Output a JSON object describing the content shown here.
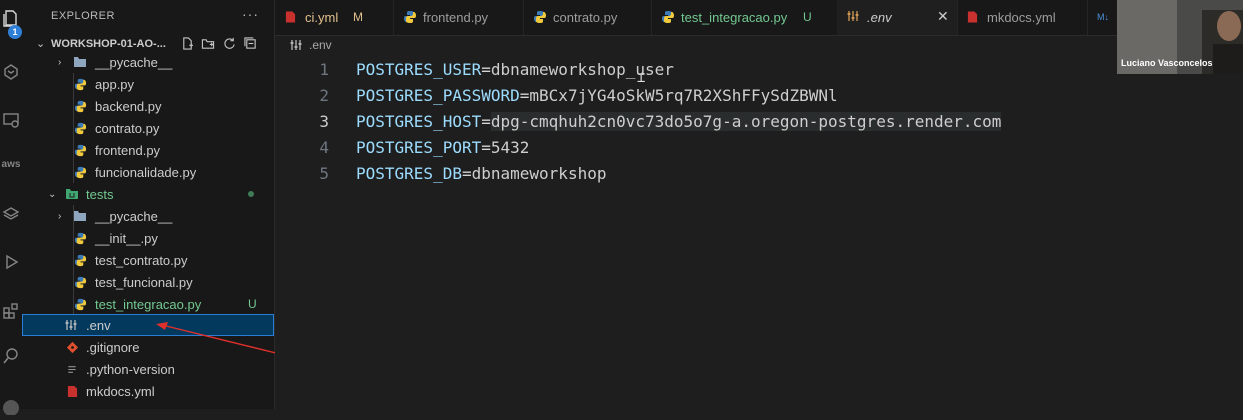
{
  "activity_bar": {
    "explorer_badge": "1",
    "items": [
      "files-icon",
      "remote-icon",
      "remote-explorer-icon",
      "aws-icon",
      "layers-icon",
      "run-debug-icon",
      "extensions-icon",
      "search-icon",
      "account-icon"
    ],
    "aws_label": "aws"
  },
  "sidebar": {
    "header": "EXPLORER",
    "more": "···",
    "workspace": "WORKSHOP-01-AO-...",
    "tree": [
      {
        "label": "__pycache__",
        "kind": "folder"
      },
      {
        "label": "app.py",
        "kind": "py"
      },
      {
        "label": "backend.py",
        "kind": "py"
      },
      {
        "label": "contrato.py",
        "kind": "py"
      },
      {
        "label": "frontend.py",
        "kind": "py"
      },
      {
        "label": "funcionalidade.py",
        "kind": "py"
      },
      {
        "label": "tests",
        "kind": "test-folder"
      },
      {
        "label": "__pycache__",
        "kind": "folder"
      },
      {
        "label": "__init__.py",
        "kind": "py"
      },
      {
        "label": "test_contrato.py",
        "kind": "py"
      },
      {
        "label": "test_funcional.py",
        "kind": "py"
      },
      {
        "label": "test_integracao.py",
        "kind": "py",
        "status": "U"
      },
      {
        "label": ".env",
        "kind": "env"
      },
      {
        "label": ".gitignore",
        "kind": "git"
      },
      {
        "label": ".python-version",
        "kind": "text"
      },
      {
        "label": "mkdocs.yml",
        "kind": "yml"
      }
    ]
  },
  "tabs": [
    {
      "label": "ci.yml",
      "mark": "M",
      "icon": "yaml-icon"
    },
    {
      "label": "frontend.py",
      "icon": "python-icon"
    },
    {
      "label": "contrato.py",
      "icon": "python-icon"
    },
    {
      "label": "test_integracao.py",
      "mark": "U",
      "icon": "python-icon"
    },
    {
      "label": ".env",
      "icon": "env-icon",
      "active": true
    },
    {
      "label": "mkdocs.yml",
      "icon": "yaml-icon"
    },
    {
      "label": "M↓",
      "icon": "markdown-icon"
    }
  ],
  "breadcrumb": ".env",
  "editor": {
    "lines": [
      {
        "n": "1",
        "key": "POSTGRES_USER",
        "eq": "=",
        "value": "dbnameworkshop_user"
      },
      {
        "n": "2",
        "key": "POSTGRES_PASSWORD",
        "eq": "=",
        "value": "mBCx7jYG4oSkW5rq7R2XShFFySdZBWNl"
      },
      {
        "n": "3",
        "key": "POSTGRES_HOST",
        "eq": "=",
        "value": "dpg-cmqhuh2cn0vc73do5o7g-a.oregon-postgres.render.com"
      },
      {
        "n": "4",
        "key": "POSTGRES_PORT",
        "eq": "=",
        "value": "5432"
      },
      {
        "n": "5",
        "key": "POSTGRES_DB",
        "eq": "=",
        "value": "dbnameworkshop"
      }
    ]
  },
  "video": {
    "name": "Luciano Vasconcelos"
  },
  "colors": {
    "accent": "#2f7fd6",
    "selection": "#04395e",
    "untracked": "#73c991",
    "modified": "#e2c08d",
    "annotation": "#e0302b"
  }
}
